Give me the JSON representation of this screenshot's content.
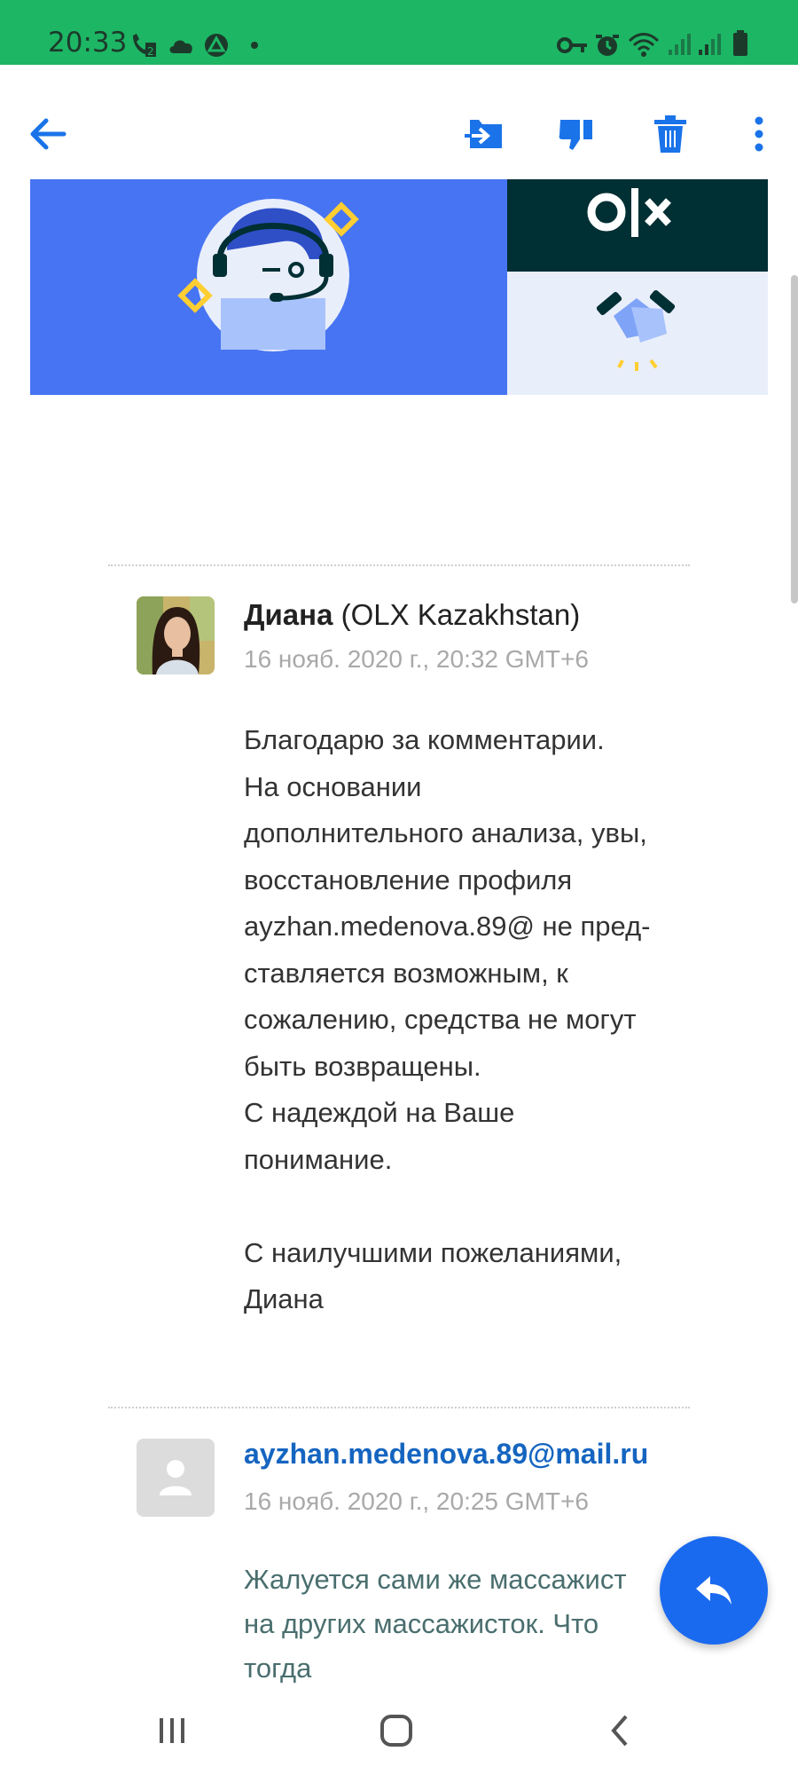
{
  "status_bar": {
    "time": "20:33",
    "background": "#1db665",
    "icons": [
      "call-icon",
      "cloud-icon",
      "drive-icon",
      "dot-icon",
      "key-icon",
      "alarm-icon",
      "wifi-icon",
      "signal-icon",
      "signal-icon",
      "battery-icon"
    ]
  },
  "app_bar": {
    "icons": [
      "back-arrow-icon",
      "move-to-icon",
      "report-spam-icon",
      "delete-icon",
      "more-options-icon"
    ],
    "accent": "#1a73e8"
  },
  "banner": {
    "logo_text": "OLX",
    "colors": {
      "left": "#4774f2",
      "right_top": "#002f34",
      "right_bottom": "#e9eefb",
      "accent": "#ffce32"
    }
  },
  "messages": [
    {
      "sender_name": "Диана",
      "sender_org": "(OLX Kazakhstan)",
      "date": "16 нояб. 2020 г., 20:32 GMT+6",
      "body": {
        "l1": "Благодарю за комментарии.",
        "l2": "На основании",
        "l3": "дополнительного анализа, увы,",
        "l4": "восстановление профиля",
        "l5": "ayzhan.medenova.89@ не пред-",
        "l6": "ставляется возможным, к",
        "l7": "сожалению, средства не могут",
        "l8": "быть возвращены.",
        "l9": "С надеждой на Ваше",
        "l10": "понимание.",
        "l11": "С наилучшими пожеланиями,",
        "l12": "Диана"
      }
    },
    {
      "sender_email": "ayzhan.medenova.89@mail.ru",
      "date": "16 нояб. 2020 г., 20:25 GMT+6",
      "body": {
        "l1": "Жалуется сами же массажист",
        "l2": "на других массажисток. Что",
        "l3": "тогда"
      }
    }
  ],
  "fab": {
    "icon": "reply-icon",
    "color": "#1a6af0"
  },
  "nav_bar": {
    "icons": [
      "recent-apps-icon",
      "home-icon",
      "back-icon"
    ]
  }
}
